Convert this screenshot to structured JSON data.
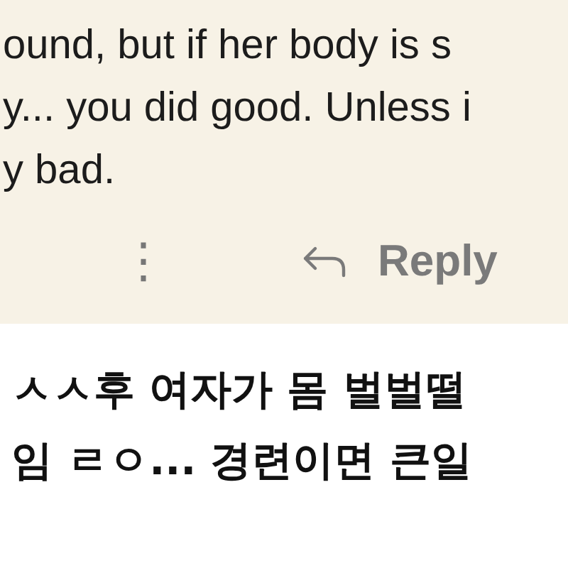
{
  "comment": {
    "lines": [
      "ound, but if her body is s",
      "y... you did good. Unless i",
      "y bad."
    ],
    "actions": {
      "more": "⋮",
      "reply": "Reply"
    }
  },
  "caption": {
    "lines": [
      "ㅅㅅ후 여자가 몸 벌벌떨",
      "임 ㄹㅇ... 경련이면 큰일"
    ]
  }
}
